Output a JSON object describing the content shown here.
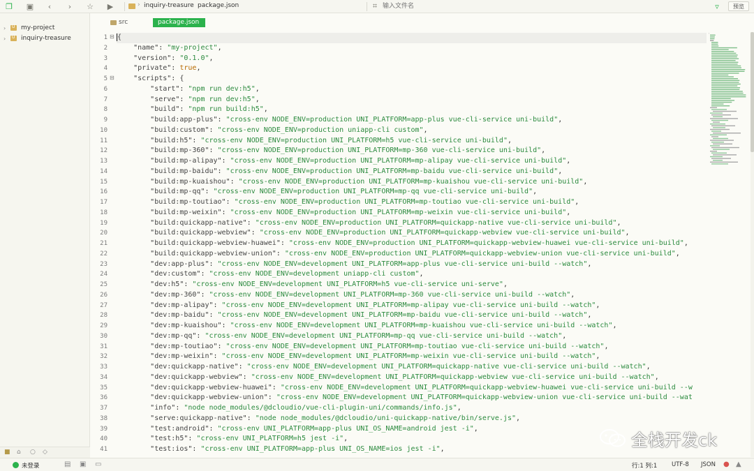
{
  "toolbar": {
    "breadcrumb": [
      "inquiry-treasure",
      "package.json"
    ],
    "search_placeholder": "输入文件名",
    "preview_label": "预览"
  },
  "sidebar": {
    "items": [
      {
        "label": "my-project"
      },
      {
        "label": "inquiry-treasure"
      }
    ]
  },
  "tabs": {
    "src_label": "src",
    "active_label": "package.json"
  },
  "editor": {
    "line_numbers": [
      "1",
      "2",
      "3",
      "4",
      "5",
      "6",
      "7",
      "8",
      "9",
      "10",
      "11",
      "12",
      "13",
      "14",
      "15",
      "16",
      "17",
      "18",
      "19",
      "20",
      "21",
      "22",
      "23",
      "24",
      "25",
      "26",
      "27",
      "28",
      "29",
      "30",
      "31",
      "32",
      "33",
      "34",
      "35",
      "36",
      "37",
      "38",
      "39",
      "40",
      "41"
    ],
    "lines": [
      {
        "indent": 0,
        "raw": "{"
      },
      {
        "indent": 1,
        "key": "name",
        "value": "my-project",
        "kind": "s"
      },
      {
        "indent": 1,
        "key": "version",
        "value": "0.1.0",
        "kind": "s"
      },
      {
        "indent": 1,
        "key": "private",
        "value": "true",
        "kind": "v"
      },
      {
        "indent": 1,
        "key": "scripts",
        "open": "{"
      },
      {
        "indent": 2,
        "key": "start",
        "value": "npm run dev:h5",
        "kind": "s"
      },
      {
        "indent": 2,
        "key": "serve",
        "value": "npm run dev:h5",
        "kind": "s"
      },
      {
        "indent": 2,
        "key": "build",
        "value": "npm run build:h5",
        "kind": "s"
      },
      {
        "indent": 2,
        "key": "build:app-plus",
        "value": "cross-env NODE_ENV=production UNI_PLATFORM=app-plus vue-cli-service uni-build",
        "kind": "s"
      },
      {
        "indent": 2,
        "key": "build:custom",
        "value": "cross-env NODE_ENV=production uniapp-cli custom",
        "kind": "s"
      },
      {
        "indent": 2,
        "key": "build:h5",
        "value": "cross-env NODE_ENV=production UNI_PLATFORM=h5 vue-cli-service uni-build",
        "kind": "s"
      },
      {
        "indent": 2,
        "key": "build:mp-360",
        "value": "cross-env NODE_ENV=production UNI_PLATFORM=mp-360 vue-cli-service uni-build",
        "kind": "s"
      },
      {
        "indent": 2,
        "key": "build:mp-alipay",
        "value": "cross-env NODE_ENV=production UNI_PLATFORM=mp-alipay vue-cli-service uni-build",
        "kind": "s"
      },
      {
        "indent": 2,
        "key": "build:mp-baidu",
        "value": "cross-env NODE_ENV=production UNI_PLATFORM=mp-baidu vue-cli-service uni-build",
        "kind": "s"
      },
      {
        "indent": 2,
        "key": "build:mp-kuaishou",
        "value": "cross-env NODE_ENV=production UNI_PLATFORM=mp-kuaishou vue-cli-service uni-build",
        "kind": "s"
      },
      {
        "indent": 2,
        "key": "build:mp-qq",
        "value": "cross-env NODE_ENV=production UNI_PLATFORM=mp-qq vue-cli-service uni-build",
        "kind": "s"
      },
      {
        "indent": 2,
        "key": "build:mp-toutiao",
        "value": "cross-env NODE_ENV=production UNI_PLATFORM=mp-toutiao vue-cli-service uni-build",
        "kind": "s"
      },
      {
        "indent": 2,
        "key": "build:mp-weixin",
        "value": "cross-env NODE_ENV=production UNI_PLATFORM=mp-weixin vue-cli-service uni-build",
        "kind": "s"
      },
      {
        "indent": 2,
        "key": "build:quickapp-native",
        "value": "cross-env NODE_ENV=production UNI_PLATFORM=quickapp-native vue-cli-service uni-build",
        "kind": "s"
      },
      {
        "indent": 2,
        "key": "build:quickapp-webview",
        "value": "cross-env NODE_ENV=production UNI_PLATFORM=quickapp-webview vue-cli-service uni-build",
        "kind": "s"
      },
      {
        "indent": 2,
        "key": "build:quickapp-webview-huawei",
        "value": "cross-env NODE_ENV=production UNI_PLATFORM=quickapp-webview-huawei vue-cli-service uni-build",
        "kind": "s"
      },
      {
        "indent": 2,
        "key": "build:quickapp-webview-union",
        "value": "cross-env NODE_ENV=production UNI_PLATFORM=quickapp-webview-union vue-cli-service uni-build",
        "kind": "s"
      },
      {
        "indent": 2,
        "key": "dev:app-plus",
        "value": "cross-env NODE_ENV=development UNI_PLATFORM=app-plus vue-cli-service uni-build --watch",
        "kind": "s"
      },
      {
        "indent": 2,
        "key": "dev:custom",
        "value": "cross-env NODE_ENV=development uniapp-cli custom",
        "kind": "s"
      },
      {
        "indent": 2,
        "key": "dev:h5",
        "value": "cross-env NODE_ENV=development UNI_PLATFORM=h5 vue-cli-service uni-serve",
        "kind": "s"
      },
      {
        "indent": 2,
        "key": "dev:mp-360",
        "value": "cross-env NODE_ENV=development UNI_PLATFORM=mp-360 vue-cli-service uni-build --watch",
        "kind": "s"
      },
      {
        "indent": 2,
        "key": "dev:mp-alipay",
        "value": "cross-env NODE_ENV=development UNI_PLATFORM=mp-alipay vue-cli-service uni-build --watch",
        "kind": "s"
      },
      {
        "indent": 2,
        "key": "dev:mp-baidu",
        "value": "cross-env NODE_ENV=development UNI_PLATFORM=mp-baidu vue-cli-service uni-build --watch",
        "kind": "s"
      },
      {
        "indent": 2,
        "key": "dev:mp-kuaishou",
        "value": "cross-env NODE_ENV=development UNI_PLATFORM=mp-kuaishou vue-cli-service uni-build --watch",
        "kind": "s"
      },
      {
        "indent": 2,
        "key": "dev:mp-qq",
        "value": "cross-env NODE_ENV=development UNI_PLATFORM=mp-qq vue-cli-service uni-build --watch",
        "kind": "s"
      },
      {
        "indent": 2,
        "key": "dev:mp-toutiao",
        "value": "cross-env NODE_ENV=development UNI_PLATFORM=mp-toutiao vue-cli-service uni-build --watch",
        "kind": "s"
      },
      {
        "indent": 2,
        "key": "dev:mp-weixin",
        "value": "cross-env NODE_ENV=development UNI_PLATFORM=mp-weixin vue-cli-service uni-build --watch",
        "kind": "s"
      },
      {
        "indent": 2,
        "key": "dev:quickapp-native",
        "value": "cross-env NODE_ENV=development UNI_PLATFORM=quickapp-native vue-cli-service uni-build --watch",
        "kind": "s"
      },
      {
        "indent": 2,
        "key": "dev:quickapp-webview",
        "value": "cross-env NODE_ENV=development UNI_PLATFORM=quickapp-webview vue-cli-service uni-build --watch",
        "kind": "s"
      },
      {
        "indent": 2,
        "key": "dev:quickapp-webview-huawei",
        "value": "cross-env NODE_ENV=development UNI_PLATFORM=quickapp-webview-huawei vue-cli-service uni-build --w",
        "kind": "s",
        "truncated": true
      },
      {
        "indent": 2,
        "key": "dev:quickapp-webview-union",
        "value": "cross-env NODE_ENV=development UNI_PLATFORM=quickapp-webview-union vue-cli-service uni-build --wat",
        "kind": "s",
        "truncated": true
      },
      {
        "indent": 2,
        "key": "info",
        "value": "node node_modules/@dcloudio/vue-cli-plugin-uni/commands/info.js",
        "kind": "s"
      },
      {
        "indent": 2,
        "key": "serve:quickapp-native",
        "value": "node node_modules/@dcloudio/uni-quickapp-native/bin/serve.js",
        "kind": "s"
      },
      {
        "indent": 2,
        "key": "test:android",
        "value": "cross-env UNI_PLATFORM=app-plus UNI_OS_NAME=android jest -i",
        "kind": "s"
      },
      {
        "indent": 2,
        "key": "test:h5",
        "value": "cross-env UNI_PLATFORM=h5 jest -i",
        "kind": "s"
      },
      {
        "indent": 2,
        "key": "test:ios",
        "value": "cross-env UNI_PLATFORM=app-plus UNI_OS_NAME=ios jest -i",
        "kind": "s"
      }
    ]
  },
  "watermark": {
    "text": "全栈开发ck"
  },
  "statusbar": {
    "login_label": "未登录",
    "position": "行:1  列:1",
    "encoding": "UTF-8",
    "language": "JSON"
  },
  "colors": {
    "accent": "#2bb24c",
    "string": "#2b8a3e",
    "literal": "#b86a00",
    "folder": "#d9b25a"
  }
}
